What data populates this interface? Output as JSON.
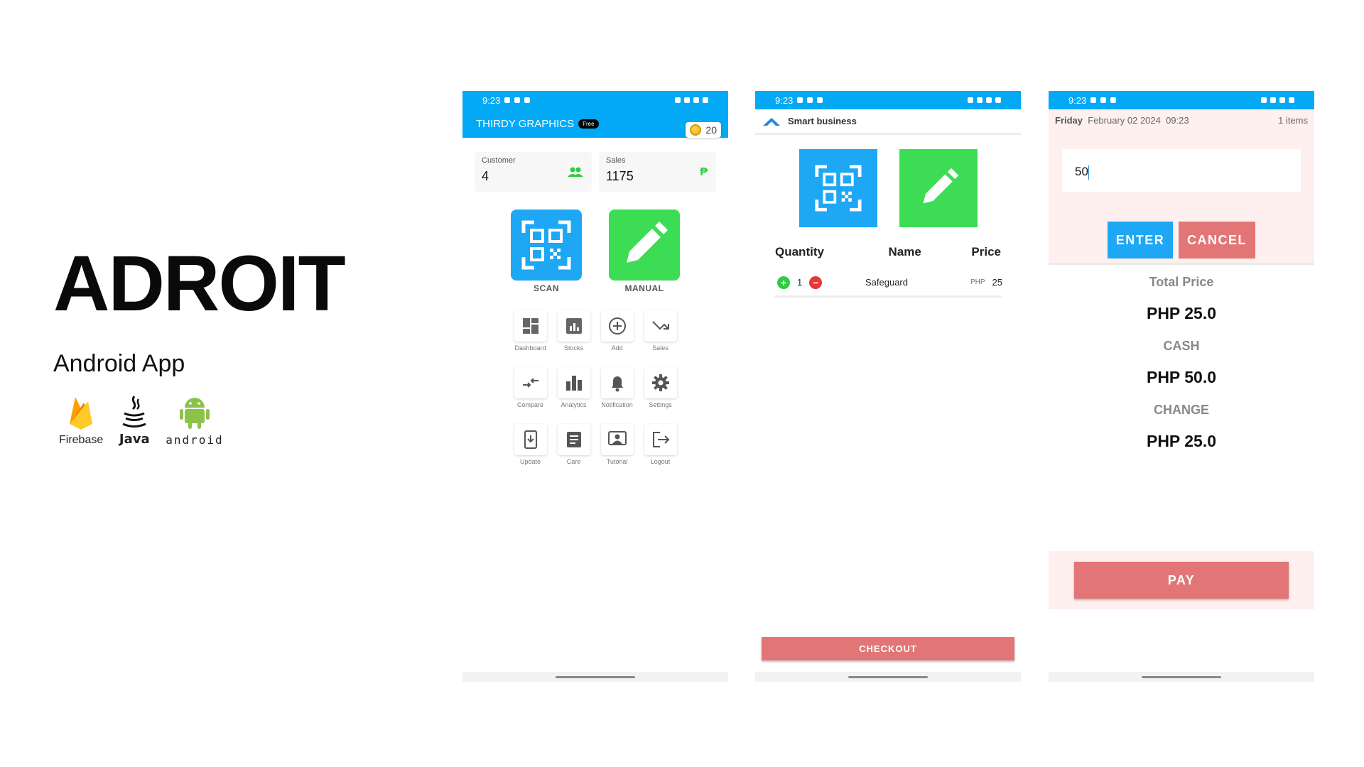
{
  "hero": {
    "title": "ADROIT",
    "subtitle": "Android App"
  },
  "tech": {
    "firebase": "Firebase",
    "java": "Java",
    "android": "android"
  },
  "status": {
    "time": "9:23"
  },
  "home": {
    "shop_name": "THIRDY GRAPHICS",
    "badge": "Free",
    "coins": "20",
    "customer_label": "Customer",
    "customer_value": "4",
    "sales_label": "Sales",
    "sales_value": "1175",
    "scan_label": "SCAN",
    "manual_label": "MANUAL",
    "grid": [
      "Dashboard",
      "Stocks",
      "Add",
      "Sales",
      "Compare",
      "Analytics",
      "Notification",
      "Settings",
      "Update",
      "Care",
      "Tutorial",
      "Logout"
    ]
  },
  "cart": {
    "app_name": "Smart business",
    "col_quantity": "Quantity",
    "col_name": "Name",
    "col_price": "Price",
    "item_qty": "1",
    "item_name": "Safeguard",
    "item_currency": "PHP",
    "item_price": "25",
    "checkout": "CHECKOUT"
  },
  "payment": {
    "day": "Friday",
    "date": "February 02 2024",
    "time": "09:23",
    "items": "1 items",
    "input_value": "50",
    "enter": "ENTER",
    "cancel": "CANCEL",
    "total_label": "Total Price",
    "total_value": "PHP 25.0",
    "cash_label": "CASH",
    "cash_value": "PHP 50.0",
    "change_label": "CHANGE",
    "change_value": "PHP 25.0",
    "pay": "PAY"
  },
  "colors": {
    "blue": "#03a9f4",
    "green": "#3ddc55",
    "red": "#e27676",
    "pink_bg": "#fdf0ee"
  }
}
